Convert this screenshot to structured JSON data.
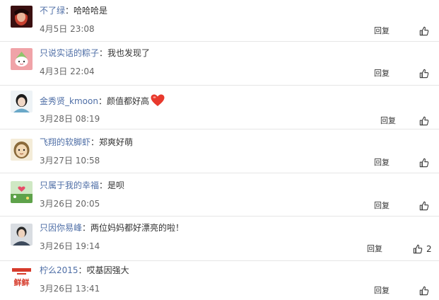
{
  "comments": [
    {
      "username": "不了绿",
      "colon": "：",
      "content": "哈哈哈是",
      "time": "4月5日 23:08",
      "reply_label": "回复",
      "likes": ""
    },
    {
      "username": "只说实话的粽子",
      "colon": "：",
      "content": "我也发现了",
      "time": "4月3日 22:04",
      "reply_label": "回复",
      "likes": ""
    },
    {
      "username": "金秀贤_kmoon",
      "colon": "：",
      "content": "颜值都好高",
      "time": "3月28日 08:19",
      "reply_label": "回复",
      "likes": ""
    },
    {
      "username": "飞翔的软脚虾",
      "colon": "：",
      "content": "郑爽好萌",
      "time": "3月27日 10:58",
      "reply_label": "回复",
      "likes": ""
    },
    {
      "username": "只属于我的幸福",
      "colon": "：",
      "content": "是呗",
      "time": "3月26日 20:05",
      "reply_label": "回复",
      "likes": ""
    },
    {
      "username": "只因你易峰",
      "colon": "：",
      "content": "两位妈妈都好漂亮的啦！",
      "time": "3月26日 19:14",
      "reply_label": "回复",
      "likes": "2"
    },
    {
      "username": "柠么2015",
      "colon": "：",
      "content": "哎基因强大",
      "time": "3月26日 13:41",
      "reply_label": "回复",
      "likes": ""
    }
  ],
  "avatar_logo_text": "鲜鲜",
  "colors": {
    "username": "#4e6ea6",
    "text": "#333333",
    "time": "#666666",
    "divider": "#e6e6e6",
    "heart": "#e8392d"
  }
}
